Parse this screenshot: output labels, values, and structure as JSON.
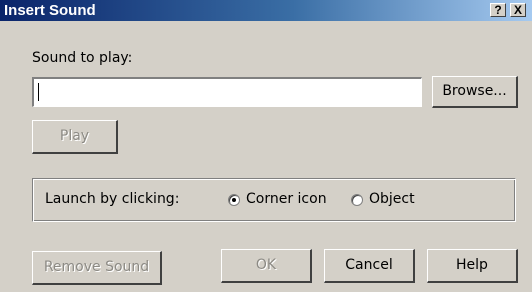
{
  "window": {
    "title": "Insert Sound",
    "help_glyph": "?",
    "close_glyph": "X"
  },
  "sound": {
    "label": "Sound to play:",
    "value": "",
    "browse_label": "Browse...",
    "play_label": "Play"
  },
  "launch": {
    "label": "Launch by clicking:",
    "options": [
      {
        "label": "Corner icon",
        "selected": true
      },
      {
        "label": "Object",
        "selected": false
      }
    ]
  },
  "footer": {
    "remove_label": "Remove Sound",
    "ok_label": "OK",
    "cancel_label": "Cancel",
    "help_label": "Help"
  },
  "colors": {
    "face": "#d4d0c8",
    "title_start": "#0a246a",
    "title_end": "#a6caf0"
  }
}
